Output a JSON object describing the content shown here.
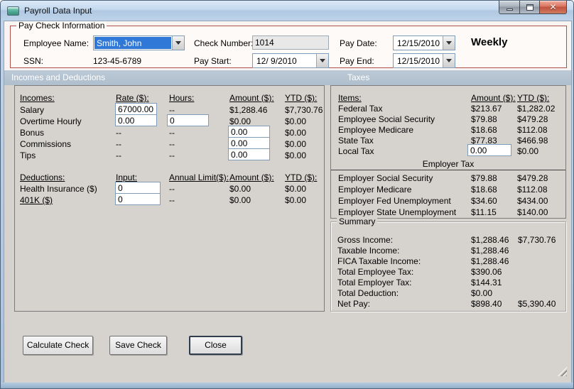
{
  "window": {
    "title": "Payroll Data Input"
  },
  "paycheck": {
    "group_label": "Pay Check Information",
    "employee_name_label": "Employee Name:",
    "employee_name_value": "Smith, John",
    "ssn_label": "SSN:",
    "ssn_value": "123-45-6789",
    "check_number_label": "Check Number:",
    "check_number_value": "1014",
    "pay_start_label": "Pay Start:",
    "pay_start_value": "12/ 9/2010",
    "pay_date_label": "Pay Date:",
    "pay_date_value": "12/15/2010",
    "pay_end_label": "Pay End:",
    "pay_end_value": "12/15/2010",
    "pay_frequency": "Weekly"
  },
  "bands": {
    "incomes_deductions": "Incomes and Deductions",
    "taxes": "Taxes"
  },
  "incomes": {
    "headers": {
      "name": "Incomes:",
      "rate": "Rate ($):",
      "hours": "Hours:",
      "amount": "Amount ($):",
      "ytd": "YTD ($):"
    },
    "rows": [
      {
        "name": "Salary",
        "rate": "67000.00",
        "hours": "--",
        "amount": "$1,288.46",
        "ytd": "$7,730.76"
      },
      {
        "name": "Overtime Hourly",
        "rate": "0.00",
        "hours": "0",
        "amount": "$0.00",
        "ytd": "$0.00"
      },
      {
        "name": "Bonus",
        "rate": "--",
        "hours": "--",
        "amount": "0.00",
        "ytd": "$0.00"
      },
      {
        "name": "Commissions",
        "rate": "--",
        "hours": "--",
        "amount": "0.00",
        "ytd": "$0.00"
      },
      {
        "name": "Tips",
        "rate": "--",
        "hours": "--",
        "amount": "0.00",
        "ytd": "$0.00"
      }
    ]
  },
  "deductions": {
    "headers": {
      "name": "Deductions:",
      "input": "Input:",
      "limit": "Annual Limit($):",
      "amount": "Amount ($):",
      "ytd": "YTD ($):"
    },
    "rows": [
      {
        "name": "Health Insurance  ($)",
        "input": "0",
        "limit": "--",
        "amount": "$0.00",
        "ytd": "$0.00"
      },
      {
        "name": "401K  ($)",
        "input": "0",
        "limit": "--",
        "amount": "$0.00",
        "ytd": "$0.00"
      }
    ]
  },
  "taxes": {
    "headers": {
      "name": "Items:",
      "amount": "Amount ($):",
      "ytd": "YTD ($):"
    },
    "employee_rows": [
      {
        "name": "Federal Tax",
        "amount": "$213.67",
        "ytd": "$1,282.02"
      },
      {
        "name": "Employee Social Security",
        "amount": "$79.88",
        "ytd": "$479.28"
      },
      {
        "name": "Employee Medicare",
        "amount": "$18.68",
        "ytd": "$112.08"
      },
      {
        "name": "State Tax",
        "amount": "$77.83",
        "ytd": "$466.98"
      },
      {
        "name": "Local Tax",
        "amount": "0.00",
        "ytd": "$0.00"
      }
    ],
    "employer_header": "Employer Tax",
    "employer_rows": [
      {
        "name": "Employer Social Security",
        "amount": "$79.88",
        "ytd": "$479.28"
      },
      {
        "name": "Employer Medicare",
        "amount": "$18.68",
        "ytd": "$112.08"
      },
      {
        "name": "Employer Fed Unemployment",
        "amount": "$34.60",
        "ytd": "$434.00"
      },
      {
        "name": "Employer State Unemployment",
        "amount": "$11.15",
        "ytd": "$140.00"
      }
    ]
  },
  "summary": {
    "group_label": "Summary",
    "rows": [
      {
        "name": "Gross Income:",
        "amount": "$1,288.46",
        "ytd": "$7,730.76"
      },
      {
        "name": "Taxable Income:",
        "amount": "$1,288.46",
        "ytd": ""
      },
      {
        "name": "FICA Taxable Income:",
        "amount": "$1,288.46",
        "ytd": ""
      },
      {
        "name": "Total Employee Tax:",
        "amount": "$390.06",
        "ytd": ""
      },
      {
        "name": "Total Employer Tax:",
        "amount": "$144.31",
        "ytd": ""
      },
      {
        "name": "Total Deduction:",
        "amount": "$0.00",
        "ytd": ""
      },
      {
        "name": "Net Pay:",
        "amount": "$898.40",
        "ytd": "$5,390.40"
      }
    ]
  },
  "buttons": {
    "calculate": "Calculate Check",
    "save": "Save Check",
    "close": "Close"
  },
  "colors": {
    "paycheck_border": "#b0504a",
    "band_background": "#b5c3d1",
    "combo_selection": "#3078d7",
    "close_button_red": "#c05340"
  }
}
